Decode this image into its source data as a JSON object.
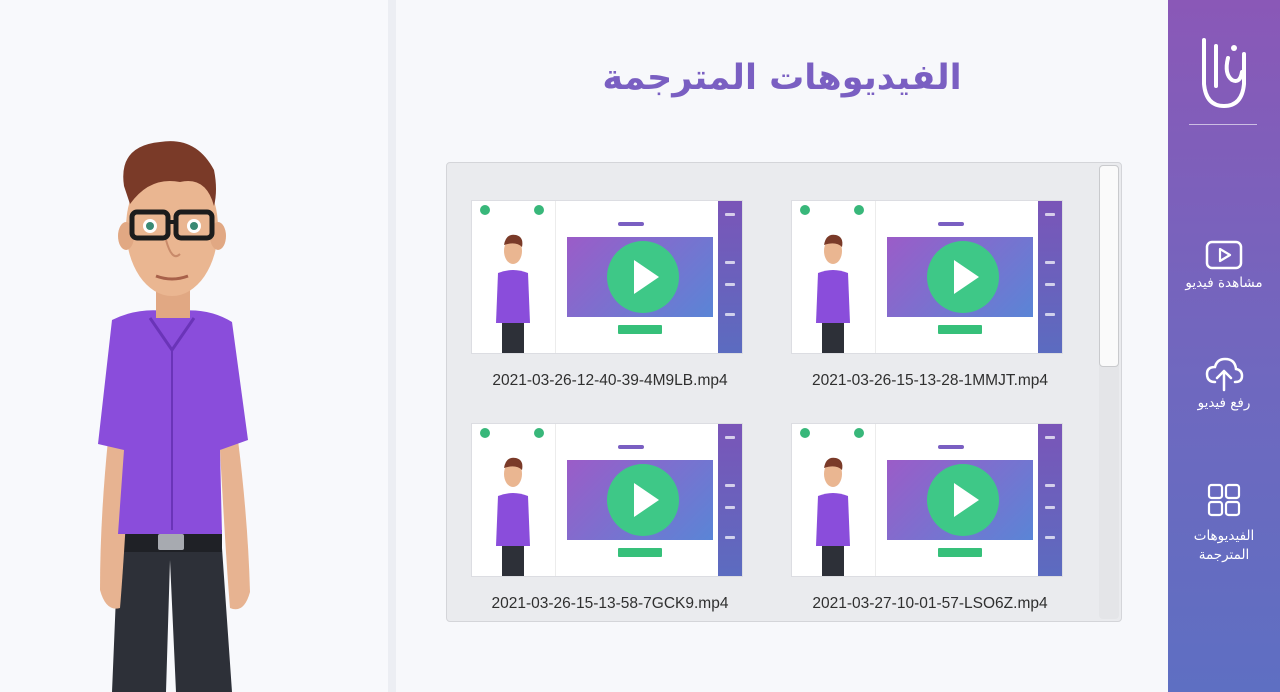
{
  "main": {
    "title": "الفيديوهات المترجمة"
  },
  "gallery": {
    "videos": [
      {
        "file_name": "2021-03-26-15-13-28-1MMJT.mp4"
      },
      {
        "file_name": "2021-03-26-12-40-39-4M9LB.mp4"
      },
      {
        "file_name": "2021-03-27-10-01-57-LSO6Z.mp4"
      },
      {
        "file_name": "2021-03-26-15-13-58-7GCK9.mp4"
      }
    ]
  },
  "sidebar": {
    "items": [
      {
        "label": "مشاهدة فيديو",
        "icon": "play-video-icon"
      },
      {
        "label": "رفع فيديو",
        "icon": "cloud-upload-icon"
      },
      {
        "label": "الفيديوهات المترجمة",
        "icon": "grid-icon"
      }
    ]
  },
  "colors": {
    "accent": "#7a5fc2",
    "sidebar_top": "#8a58b7",
    "sidebar_bottom": "#5e6fc2",
    "play_green": "#3ec887"
  }
}
